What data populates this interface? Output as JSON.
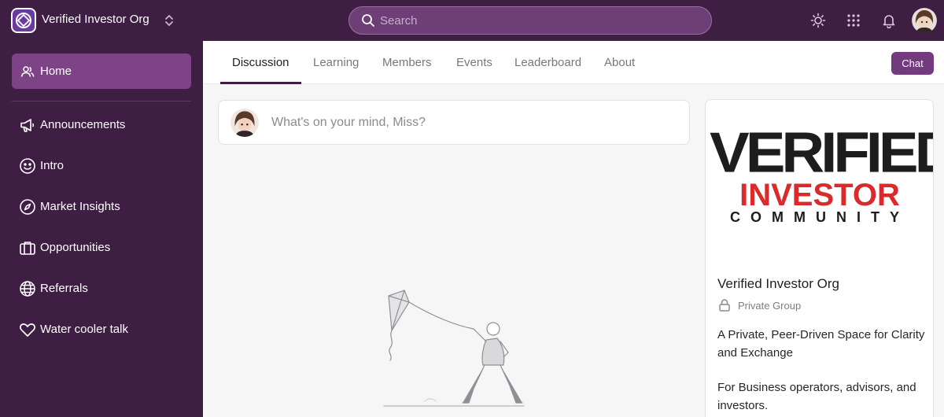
{
  "header": {
    "org_name": "Verified Investor Org",
    "search_placeholder": "Search",
    "icons": [
      "sun-icon",
      "apps-grid-icon",
      "bell-icon"
    ]
  },
  "sidebar": {
    "items": [
      {
        "label": "Home",
        "icon": "people-icon",
        "active": true
      },
      {
        "label": "Announcements",
        "icon": "megaphone-icon"
      },
      {
        "label": "Intro",
        "icon": "smile-icon"
      },
      {
        "label": "Market Insights",
        "icon": "compass-icon"
      },
      {
        "label": "Opportunities",
        "icon": "briefcase-icon"
      },
      {
        "label": "Referrals",
        "icon": "globe-icon"
      },
      {
        "label": "Water cooler talk",
        "icon": "heart-icon"
      }
    ]
  },
  "tabs": [
    {
      "label": "Discussion",
      "active": true
    },
    {
      "label": "Learning"
    },
    {
      "label": "Members"
    },
    {
      "label": "Events"
    },
    {
      "label": "Leaderboard"
    },
    {
      "label": "About"
    }
  ],
  "chat_label": "Chat",
  "composer": {
    "placeholder": "What's on your mind, Miss?"
  },
  "group": {
    "banner_line1": "VERIFIED",
    "banner_line2": "INVESTOR",
    "banner_line3": "COMMUNITY",
    "name": "Verified Investor Org",
    "privacy": "Private Group",
    "description_1": "A Private, Peer-Driven Space for Clarity and Exchange",
    "description_2": "For Business operators, advisors, and investors."
  },
  "colors": {
    "nav_bg": "#3f1e44",
    "active_item": "#7e4387",
    "accent_button": "#743a7e",
    "banner_red": "#d92b2b"
  }
}
